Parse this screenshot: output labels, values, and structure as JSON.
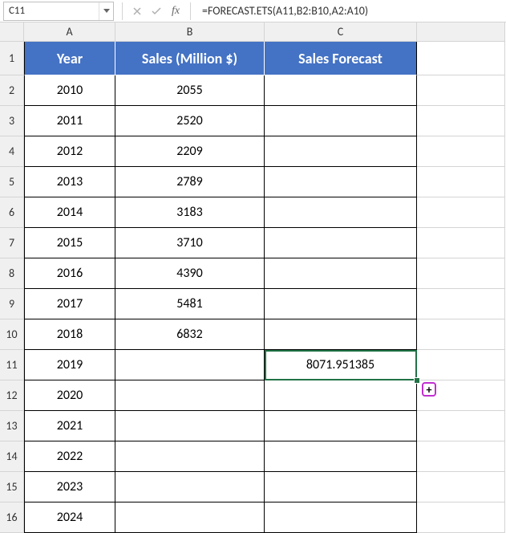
{
  "nameBox": {
    "value": "C11"
  },
  "formula": "=FORECAST.ETS(A11,B2:B10,A2:A10)",
  "columns": [
    "A",
    "B",
    "C"
  ],
  "headerRow": {
    "a": "Year",
    "b": "Sales (Million $)",
    "c": "Sales Forecast"
  },
  "rows": [
    {
      "n": "1"
    },
    {
      "n": "2",
      "a": "2010",
      "b": "2055",
      "c": ""
    },
    {
      "n": "3",
      "a": "2011",
      "b": "2520",
      "c": ""
    },
    {
      "n": "4",
      "a": "2012",
      "b": "2209",
      "c": ""
    },
    {
      "n": "5",
      "a": "2013",
      "b": "2789",
      "c": ""
    },
    {
      "n": "6",
      "a": "2014",
      "b": "3183",
      "c": ""
    },
    {
      "n": "7",
      "a": "2015",
      "b": "3710",
      "c": ""
    },
    {
      "n": "8",
      "a": "2016",
      "b": "4390",
      "c": ""
    },
    {
      "n": "9",
      "a": "2017",
      "b": "5481",
      "c": ""
    },
    {
      "n": "10",
      "a": "2018",
      "b": "6832",
      "c": ""
    },
    {
      "n": "11",
      "a": "2019",
      "b": "",
      "c": "8071.951385"
    },
    {
      "n": "12",
      "a": "2020",
      "b": "",
      "c": ""
    },
    {
      "n": "13",
      "a": "2021",
      "b": "",
      "c": ""
    },
    {
      "n": "14",
      "a": "2022",
      "b": "",
      "c": ""
    },
    {
      "n": "15",
      "a": "2023",
      "b": "",
      "c": ""
    },
    {
      "n": "16",
      "a": "2024",
      "b": "",
      "c": ""
    }
  ],
  "selection": {
    "cell": "C11"
  }
}
